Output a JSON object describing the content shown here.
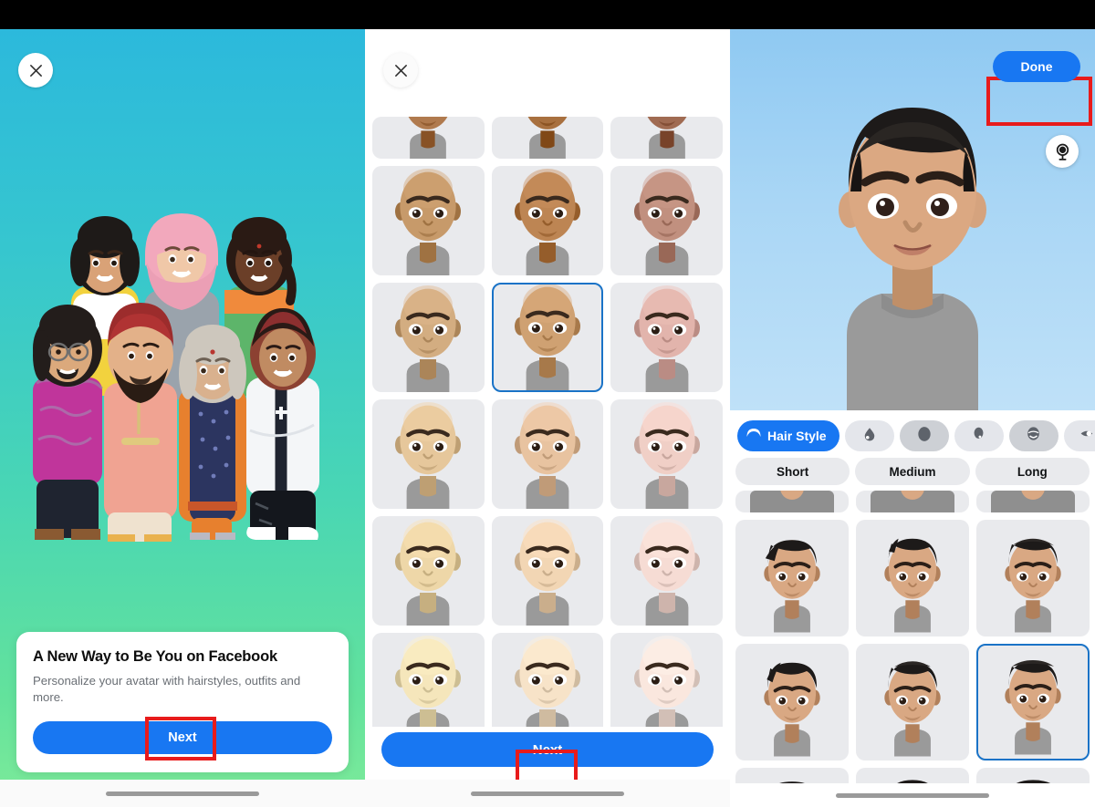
{
  "app": {
    "name": "Facebook Avatar",
    "accent_color": "#1877f2",
    "highlight_color": "#e81b1b",
    "selected_border_color": "#1a73c7",
    "tile_bg_color": "#e9eaed"
  },
  "panel1": {
    "name": "avatar-intro-screen",
    "close_icon": "close-icon",
    "background_gradient_from": "#2cb9dc",
    "background_gradient_to": "#7eeb9a",
    "illustration": "diverse-avatar-group-illustration",
    "illustration_people_count": 7,
    "card": {
      "title": "A New Way to Be You on Facebook",
      "subtitle": "Personalize your avatar with hairstyles, outfits and more.",
      "button_label": "Next",
      "button_highlighted": true
    }
  },
  "panel2": {
    "name": "skin-tone-picker-screen",
    "close_icon": "close-icon",
    "next_button_label": "Next",
    "next_button_highlighted": true,
    "grid": {
      "columns": 3,
      "selected_index": 7,
      "skin_tones": [
        "#b07a4e",
        "#a8703f",
        "#a06b52",
        "#c79a6a",
        "#bd8553",
        "#c1907f",
        "#d3ad81",
        "#cfa172",
        "#e2b4ac",
        "#e6c79b",
        "#e8c3a0",
        "#f0cfc6",
        "#eed7a8",
        "#f2d6b4",
        "#f6dcd4",
        "#f5e6bb",
        "#f7e3c8",
        "#fae7de"
      ]
    }
  },
  "panel3": {
    "name": "avatar-editor-screen",
    "done_button_label": "Done",
    "done_button_highlighted": true,
    "mirror_icon": "mirror-icon",
    "preview_gradient_from": "#8fc9f2",
    "preview_gradient_to": "#bfe1f8",
    "avatar": {
      "skin_tone": "#d9a883",
      "hair_color": "#1d1a19",
      "shirt_color": "#9a9a9a"
    },
    "categories": [
      {
        "label": "Hair Style",
        "icon": "hair-style-icon",
        "active": true
      },
      {
        "label": "",
        "icon": "skin-tone-droplet-icon",
        "active": false
      },
      {
        "label": "",
        "icon": "face-shape-icon",
        "active": false
      },
      {
        "label": "",
        "icon": "hair-color-icon",
        "active": false
      },
      {
        "label": "",
        "icon": "facial-hair-icon",
        "active": false
      },
      {
        "label": "",
        "icon": "eyes-icon",
        "active": false
      }
    ],
    "subtabs": [
      {
        "label": "Short",
        "active": false
      },
      {
        "label": "Medium",
        "active": false
      },
      {
        "label": "Long",
        "active": false
      }
    ],
    "hair_grid": {
      "columns": 3,
      "selected_index": 5
    }
  }
}
